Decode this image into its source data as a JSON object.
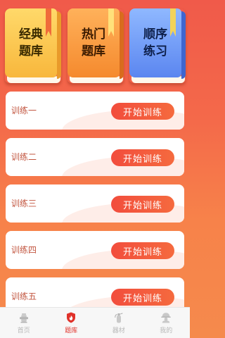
{
  "books": [
    {
      "line1": "经典",
      "line2": "题库"
    },
    {
      "line1": "热门",
      "line2": "题库"
    },
    {
      "line1": "顺序",
      "line2": "练习"
    }
  ],
  "trainings": [
    {
      "label": "训练一",
      "button": "开始训练"
    },
    {
      "label": "训练二",
      "button": "开始训练"
    },
    {
      "label": "训练三",
      "button": "开始训练"
    },
    {
      "label": "训练四",
      "button": "开始训练"
    },
    {
      "label": "训练五",
      "button": "开始训练"
    }
  ],
  "tabbar": {
    "items": [
      {
        "label": "首页",
        "icon": "hydrant-icon"
      },
      {
        "label": "题库",
        "icon": "flame-shield-icon",
        "active": true
      },
      {
        "label": "器材",
        "icon": "extinguisher-icon"
      },
      {
        "label": "我的",
        "icon": "firefighter-icon"
      }
    ]
  },
  "colors": {
    "accent": "#e0322a",
    "button": "#f24d3d"
  }
}
